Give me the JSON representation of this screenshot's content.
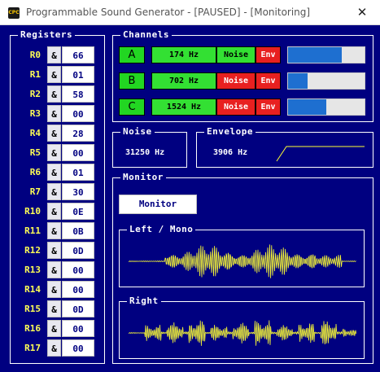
{
  "window": {
    "icon_text": "CPC",
    "title": "Programmable Sound Generator - [PAUSED] - [Monitoring]",
    "close_glyph": "✕"
  },
  "registers": {
    "title": "Registers",
    "amp": "&",
    "items": [
      {
        "label": "R0",
        "value": "66"
      },
      {
        "label": "R1",
        "value": "01"
      },
      {
        "label": "R2",
        "value": "58"
      },
      {
        "label": "R3",
        "value": "00"
      },
      {
        "label": "R4",
        "value": "28"
      },
      {
        "label": "R5",
        "value": "00"
      },
      {
        "label": "R6",
        "value": "01"
      },
      {
        "label": "R7",
        "value": "30"
      },
      {
        "label": "R10",
        "value": "0E"
      },
      {
        "label": "R11",
        "value": "0B"
      },
      {
        "label": "R12",
        "value": "0D"
      },
      {
        "label": "R13",
        "value": "00"
      },
      {
        "label": "R14",
        "value": "00"
      },
      {
        "label": "R15",
        "value": "0D"
      },
      {
        "label": "R16",
        "value": "00"
      },
      {
        "label": "R17",
        "value": "00"
      }
    ]
  },
  "channels": {
    "title": "Channels",
    "items": [
      {
        "letter": "A",
        "freq": "174 Hz",
        "noise": "Noise",
        "noise_on": true,
        "env": "Env",
        "level": 0.7
      },
      {
        "letter": "B",
        "freq": "702 Hz",
        "noise": "Noise",
        "noise_on": false,
        "env": "Env",
        "level": 0.25
      },
      {
        "letter": "C",
        "freq": "1524 Hz",
        "noise": "Noise",
        "noise_on": false,
        "env": "Env",
        "level": 0.5
      }
    ]
  },
  "noise": {
    "title": "Noise",
    "value": "31250 Hz"
  },
  "envelope": {
    "title": "Envelope",
    "value": "3906 Hz"
  },
  "monitor": {
    "title": "Monitor",
    "button_label": "Monitor",
    "left_title": "Left / Mono",
    "right_title": "Right",
    "wave_color": "#ffff33"
  },
  "colors": {
    "background": "#000080",
    "label_yellow": "#ffff55",
    "channel_green": "#33e033",
    "channel_red": "#e82020",
    "level_blue": "#1e6fd0"
  }
}
